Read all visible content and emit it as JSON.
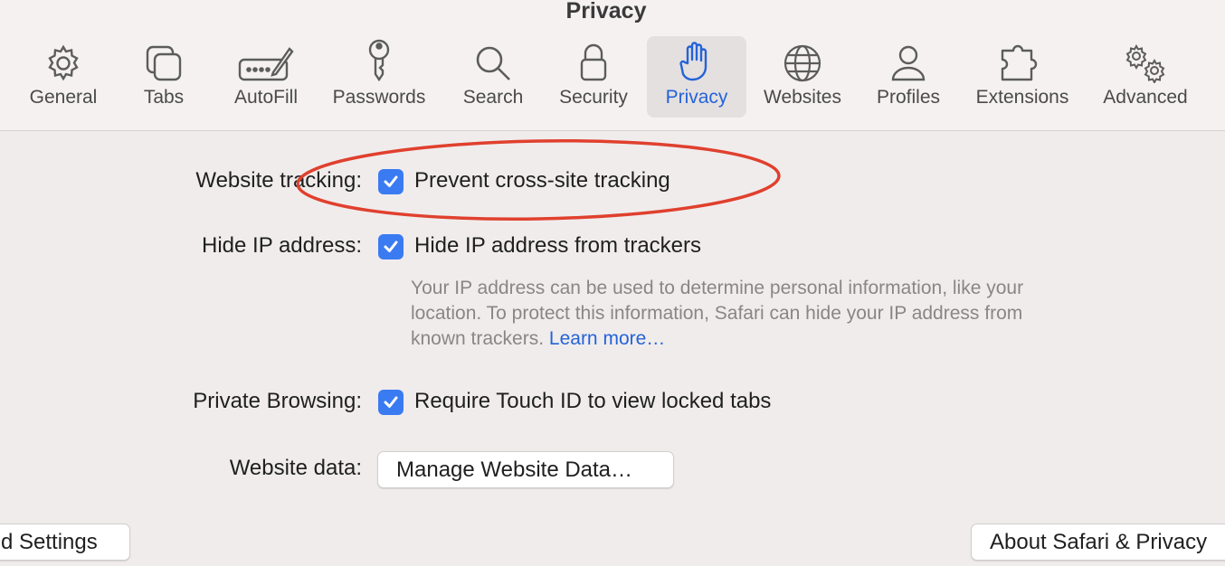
{
  "window": {
    "title": "Privacy"
  },
  "toolbar": {
    "tabs": [
      {
        "label": "General",
        "icon": "gear-icon"
      },
      {
        "label": "Tabs",
        "icon": "tabs-icon"
      },
      {
        "label": "AutoFill",
        "icon": "autofill-icon"
      },
      {
        "label": "Passwords",
        "icon": "key-icon"
      },
      {
        "label": "Search",
        "icon": "search-icon"
      },
      {
        "label": "Security",
        "icon": "lock-icon"
      },
      {
        "label": "Privacy",
        "icon": "hand-icon",
        "selected": true
      },
      {
        "label": "Websites",
        "icon": "globe-icon"
      },
      {
        "label": "Profiles",
        "icon": "person-icon"
      },
      {
        "label": "Extensions",
        "icon": "puzzle-icon"
      },
      {
        "label": "Advanced",
        "icon": "gears-icon"
      }
    ]
  },
  "settings": {
    "tracking": {
      "label": "Website tracking:",
      "checkbox_label": "Prevent cross-site tracking",
      "checked": true
    },
    "hide_ip": {
      "label": "Hide IP address:",
      "checkbox_label": "Hide IP address from trackers",
      "checked": true,
      "description": "Your IP address can be used to determine personal information, like your location. To protect this information, Safari can hide your IP address from known trackers.",
      "learn_more": "Learn more…"
    },
    "private_browsing": {
      "label": "Private Browsing:",
      "checkbox_label": "Require Touch ID to view locked tabs",
      "checked": true
    },
    "website_data": {
      "label": "Website data:",
      "button_label": "Manage Website Data…"
    }
  },
  "footer": {
    "left_button": "d Settings",
    "right_button": "About Safari & Privacy"
  },
  "colors": {
    "accent": "#3a7bf2",
    "link": "#2463d8",
    "annotation": "#e0402e"
  }
}
